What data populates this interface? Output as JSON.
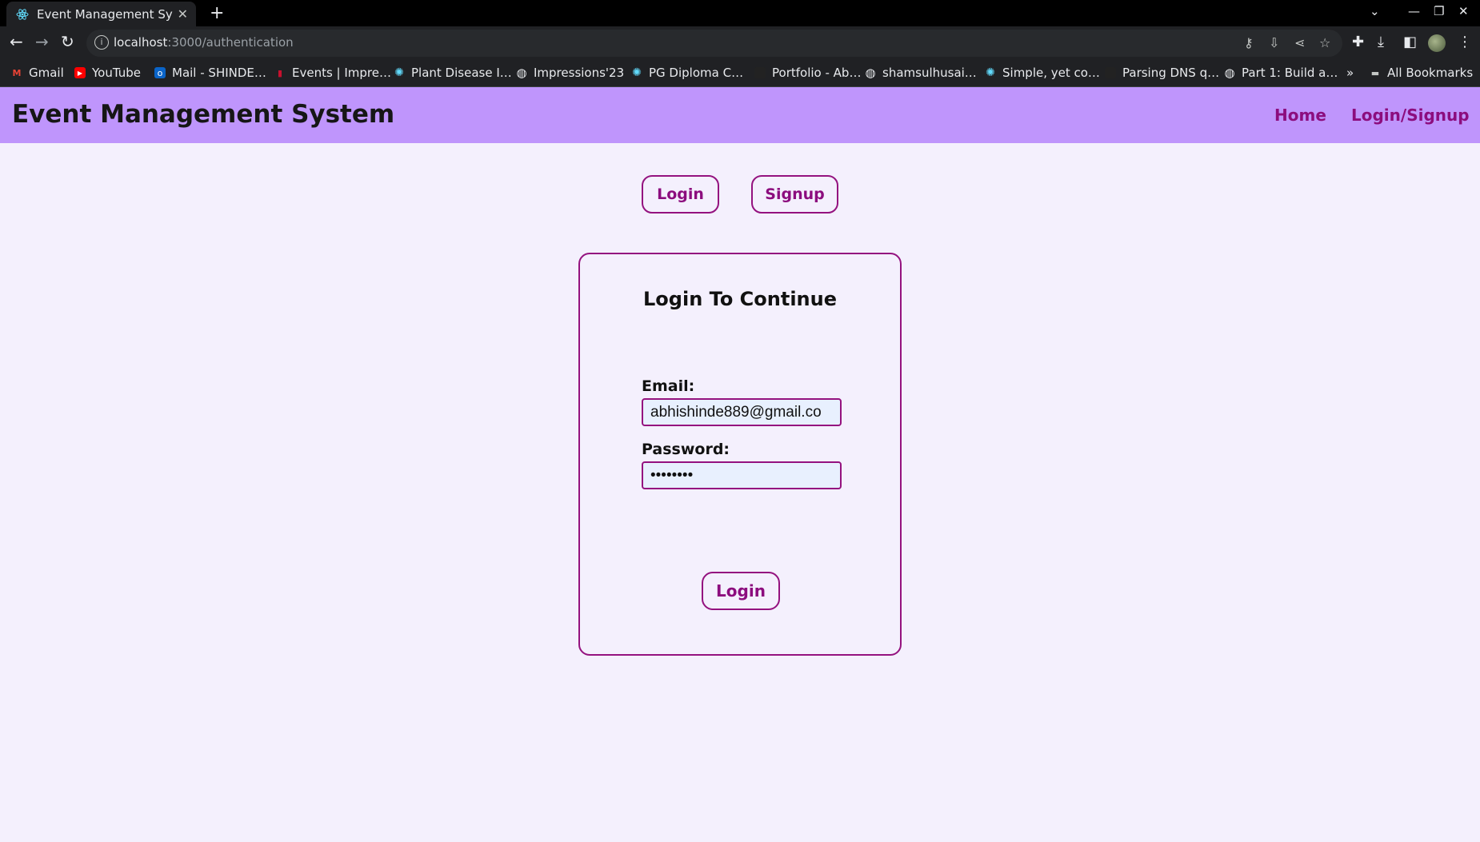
{
  "browser": {
    "tab_title": "Event Management Syste",
    "url_host": "localhost",
    "url_path": ":3000/authentication",
    "bookmarks": [
      {
        "label": "Gmail",
        "icon": "gmail-icon",
        "color": "#ea4335"
      },
      {
        "label": "YouTube",
        "icon": "youtube-icon",
        "color": "#ff0000"
      },
      {
        "label": "Mail - SHINDE…",
        "icon": "outlook-icon",
        "color": "#0a64c8"
      },
      {
        "label": "Events | Impre…",
        "icon": "events-icon",
        "color": "#c8102e"
      },
      {
        "label": "Plant Disease I…",
        "icon": "react-icon",
        "color": "#61dafb"
      },
      {
        "label": "Impressions'23",
        "icon": "globe-icon",
        "color": "#e8eaed"
      },
      {
        "label": "PG Diploma C…",
        "icon": "react-icon",
        "color": "#61dafb"
      },
      {
        "label": "Portfolio - Ab…",
        "icon": "dark-icon",
        "color": "#222222"
      },
      {
        "label": "shamsulhusai…",
        "icon": "globe-icon",
        "color": "#e8eaed"
      },
      {
        "label": "Simple, yet co…",
        "icon": "react-icon",
        "color": "#61dafb"
      },
      {
        "label": "Parsing DNS q…",
        "icon": "dark-icon",
        "color": "#222222"
      },
      {
        "label": "Part 1: Build a…",
        "icon": "globe-icon",
        "color": "#e8eaed"
      }
    ],
    "more_bookmarks": "»",
    "all_bookmarks": "All Bookmarks"
  },
  "header": {
    "brand": "Event Management System",
    "nav": {
      "home": "Home",
      "auth": "Login/Signup"
    }
  },
  "auth_toggle": {
    "login": "Login",
    "signup": "Signup"
  },
  "login_card": {
    "title": "Login To Continue",
    "email_label": "Email:",
    "email_value": "abhishinde889@gmail.co",
    "password_label": "Password:",
    "password_value": "••••••••",
    "submit": "Login"
  },
  "colors": {
    "header_bg": "#bf95fc",
    "accent": "#8c0d7e",
    "page_bg": "#f4f0fd"
  }
}
